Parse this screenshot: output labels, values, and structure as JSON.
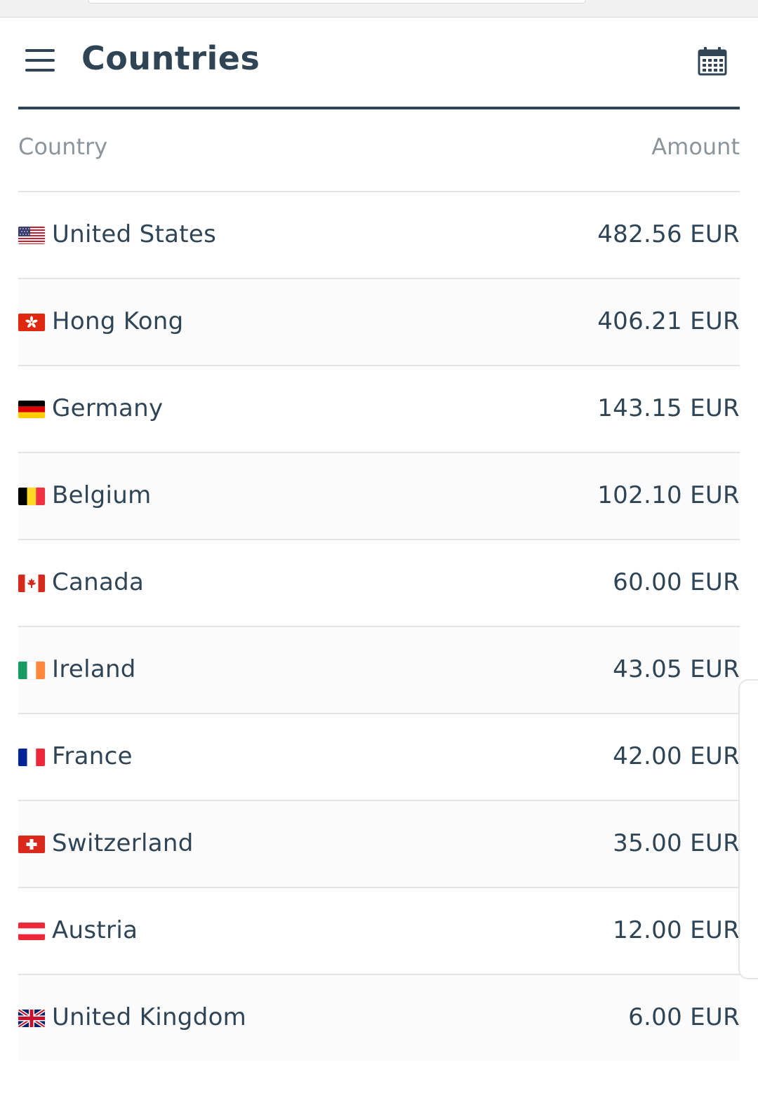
{
  "header": {
    "title": "Countries",
    "menu_icon": "hamburger-menu-icon",
    "calendar_icon": "calendar-icon"
  },
  "table": {
    "columns": {
      "country": "Country",
      "amount": "Amount"
    },
    "rows": [
      {
        "country": "United States",
        "amount": "482.56 EUR",
        "flag": "us-flag-icon"
      },
      {
        "country": "Hong Kong",
        "amount": "406.21 EUR",
        "flag": "hk-flag-icon"
      },
      {
        "country": "Germany",
        "amount": "143.15 EUR",
        "flag": "de-flag-icon"
      },
      {
        "country": "Belgium",
        "amount": "102.10 EUR",
        "flag": "be-flag-icon"
      },
      {
        "country": "Canada",
        "amount": "60.00 EUR",
        "flag": "ca-flag-icon"
      },
      {
        "country": "Ireland",
        "amount": "43.05 EUR",
        "flag": "ie-flag-icon"
      },
      {
        "country": "France",
        "amount": "42.00 EUR",
        "flag": "fr-flag-icon"
      },
      {
        "country": "Switzerland",
        "amount": "35.00 EUR",
        "flag": "ch-flag-icon"
      },
      {
        "country": "Austria",
        "amount": "12.00 EUR",
        "flag": "at-flag-icon"
      },
      {
        "country": "United Kingdom",
        "amount": "6.00 EUR",
        "flag": "gb-flag-icon"
      }
    ]
  },
  "colors": {
    "primary": "#2f4555",
    "muted": "#8b959d",
    "divider": "#e2e5e8"
  }
}
